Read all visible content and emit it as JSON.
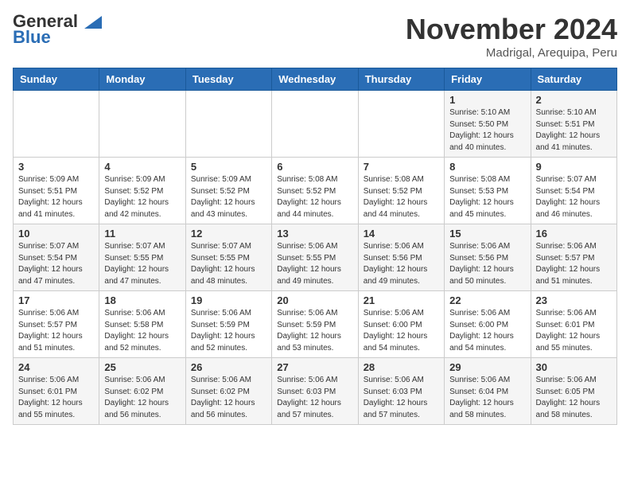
{
  "header": {
    "logo_line1": "General",
    "logo_line2": "Blue",
    "month_title": "November 2024",
    "location": "Madrigal, Arequipa, Peru"
  },
  "weekdays": [
    "Sunday",
    "Monday",
    "Tuesday",
    "Wednesday",
    "Thursday",
    "Friday",
    "Saturday"
  ],
  "weeks": [
    [
      {
        "day": "",
        "info": ""
      },
      {
        "day": "",
        "info": ""
      },
      {
        "day": "",
        "info": ""
      },
      {
        "day": "",
        "info": ""
      },
      {
        "day": "",
        "info": ""
      },
      {
        "day": "1",
        "info": "Sunrise: 5:10 AM\nSunset: 5:50 PM\nDaylight: 12 hours\nand 40 minutes."
      },
      {
        "day": "2",
        "info": "Sunrise: 5:10 AM\nSunset: 5:51 PM\nDaylight: 12 hours\nand 41 minutes."
      }
    ],
    [
      {
        "day": "3",
        "info": "Sunrise: 5:09 AM\nSunset: 5:51 PM\nDaylight: 12 hours\nand 41 minutes."
      },
      {
        "day": "4",
        "info": "Sunrise: 5:09 AM\nSunset: 5:52 PM\nDaylight: 12 hours\nand 42 minutes."
      },
      {
        "day": "5",
        "info": "Sunrise: 5:09 AM\nSunset: 5:52 PM\nDaylight: 12 hours\nand 43 minutes."
      },
      {
        "day": "6",
        "info": "Sunrise: 5:08 AM\nSunset: 5:52 PM\nDaylight: 12 hours\nand 44 minutes."
      },
      {
        "day": "7",
        "info": "Sunrise: 5:08 AM\nSunset: 5:52 PM\nDaylight: 12 hours\nand 44 minutes."
      },
      {
        "day": "8",
        "info": "Sunrise: 5:08 AM\nSunset: 5:53 PM\nDaylight: 12 hours\nand 45 minutes."
      },
      {
        "day": "9",
        "info": "Sunrise: 5:07 AM\nSunset: 5:54 PM\nDaylight: 12 hours\nand 46 minutes."
      }
    ],
    [
      {
        "day": "10",
        "info": "Sunrise: 5:07 AM\nSunset: 5:54 PM\nDaylight: 12 hours\nand 47 minutes."
      },
      {
        "day": "11",
        "info": "Sunrise: 5:07 AM\nSunset: 5:55 PM\nDaylight: 12 hours\nand 47 minutes."
      },
      {
        "day": "12",
        "info": "Sunrise: 5:07 AM\nSunset: 5:55 PM\nDaylight: 12 hours\nand 48 minutes."
      },
      {
        "day": "13",
        "info": "Sunrise: 5:06 AM\nSunset: 5:55 PM\nDaylight: 12 hours\nand 49 minutes."
      },
      {
        "day": "14",
        "info": "Sunrise: 5:06 AM\nSunset: 5:56 PM\nDaylight: 12 hours\nand 49 minutes."
      },
      {
        "day": "15",
        "info": "Sunrise: 5:06 AM\nSunset: 5:56 PM\nDaylight: 12 hours\nand 50 minutes."
      },
      {
        "day": "16",
        "info": "Sunrise: 5:06 AM\nSunset: 5:57 PM\nDaylight: 12 hours\nand 51 minutes."
      }
    ],
    [
      {
        "day": "17",
        "info": "Sunrise: 5:06 AM\nSunset: 5:57 PM\nDaylight: 12 hours\nand 51 minutes."
      },
      {
        "day": "18",
        "info": "Sunrise: 5:06 AM\nSunset: 5:58 PM\nDaylight: 12 hours\nand 52 minutes."
      },
      {
        "day": "19",
        "info": "Sunrise: 5:06 AM\nSunset: 5:59 PM\nDaylight: 12 hours\nand 52 minutes."
      },
      {
        "day": "20",
        "info": "Sunrise: 5:06 AM\nSunset: 5:59 PM\nDaylight: 12 hours\nand 53 minutes."
      },
      {
        "day": "21",
        "info": "Sunrise: 5:06 AM\nSunset: 6:00 PM\nDaylight: 12 hours\nand 54 minutes."
      },
      {
        "day": "22",
        "info": "Sunrise: 5:06 AM\nSunset: 6:00 PM\nDaylight: 12 hours\nand 54 minutes."
      },
      {
        "day": "23",
        "info": "Sunrise: 5:06 AM\nSunset: 6:01 PM\nDaylight: 12 hours\nand 55 minutes."
      }
    ],
    [
      {
        "day": "24",
        "info": "Sunrise: 5:06 AM\nSunset: 6:01 PM\nDaylight: 12 hours\nand 55 minutes."
      },
      {
        "day": "25",
        "info": "Sunrise: 5:06 AM\nSunset: 6:02 PM\nDaylight: 12 hours\nand 56 minutes."
      },
      {
        "day": "26",
        "info": "Sunrise: 5:06 AM\nSunset: 6:02 PM\nDaylight: 12 hours\nand 56 minutes."
      },
      {
        "day": "27",
        "info": "Sunrise: 5:06 AM\nSunset: 6:03 PM\nDaylight: 12 hours\nand 57 minutes."
      },
      {
        "day": "28",
        "info": "Sunrise: 5:06 AM\nSunset: 6:03 PM\nDaylight: 12 hours\nand 57 minutes."
      },
      {
        "day": "29",
        "info": "Sunrise: 5:06 AM\nSunset: 6:04 PM\nDaylight: 12 hours\nand 58 minutes."
      },
      {
        "day": "30",
        "info": "Sunrise: 5:06 AM\nSunset: 6:05 PM\nDaylight: 12 hours\nand 58 minutes."
      }
    ]
  ]
}
